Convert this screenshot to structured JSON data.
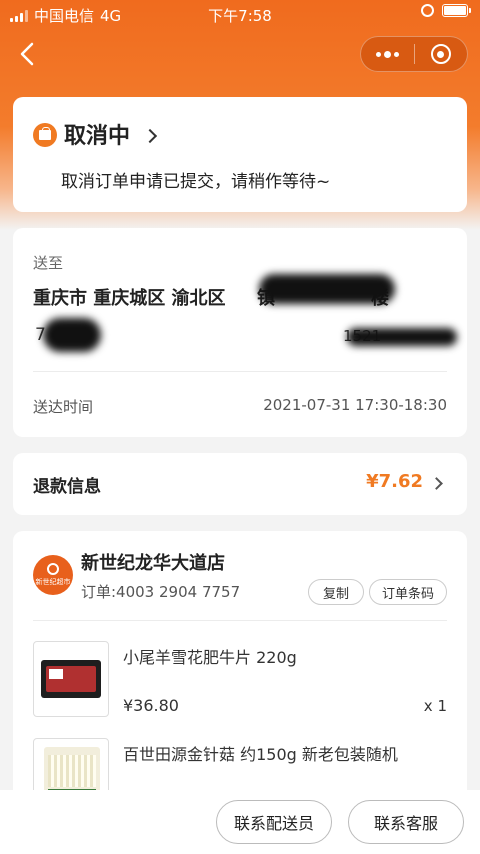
{
  "status_bar": {
    "carrier": "中国电信",
    "network": "4G",
    "time": "下午7:58"
  },
  "nav": {
    "back_icon": "chevron-left-icon",
    "more_icon": "more-dots-icon",
    "close_icon": "target-icon"
  },
  "order_status": {
    "title": "取消中",
    "description": "取消订单申请已提交，请稍作等待~"
  },
  "delivery": {
    "to_label": "送至",
    "address": "重庆市 重庆城区 渝北区",
    "address_tail": "镇",
    "address_tail_2": "楼",
    "recipient": "7",
    "phone": "1521",
    "time_label": "送达时间",
    "time_value": "2021-07-31 17:30-18:30"
  },
  "refund": {
    "label": "退款信息",
    "amount": "¥7.62"
  },
  "store": {
    "name": "新世纪龙华大道店",
    "logo_text": "新世纪超市",
    "order_no": "订单:4003 2904 7757",
    "copy_label": "复制",
    "barcode_label": "订单条码"
  },
  "products": [
    {
      "name": "小尾羊雪花肥牛片 220g",
      "price": "¥36.80",
      "qty": "x 1"
    },
    {
      "name": "百世田源金针菇 约150g 新老包装随机",
      "price": "",
      "qty": ""
    }
  ],
  "actions": {
    "contact_courier": "联系配送员",
    "contact_service": "联系客服"
  },
  "colors": {
    "accent": "#f07a22",
    "header": "#f06b1e"
  }
}
